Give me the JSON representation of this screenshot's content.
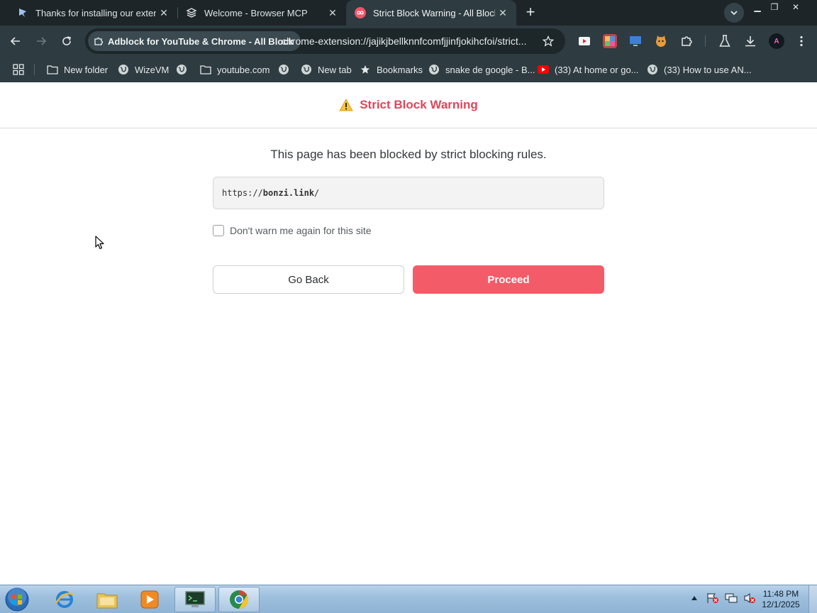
{
  "tabs": [
    {
      "title": "Thanks for installing our extension",
      "icon": "feather-icon"
    },
    {
      "title": "Welcome - Browser MCP",
      "icon": "stack-icon"
    },
    {
      "title": "Strict Block Warning - All Block",
      "icon": "infinity-icon",
      "active": true
    }
  ],
  "toolbar": {
    "site_chip": "Adblock for YouTube & Chrome - All Block",
    "url": "chrome-extension://jajikjbellknnfcomfjjinfjokihcfoi/strict..."
  },
  "bookmarks": [
    {
      "label": "New folder",
      "icon": "folder-icon"
    },
    {
      "label": "WizeVM",
      "icon": "globe-icon"
    },
    {
      "label": "",
      "icon": "globe-icon"
    },
    {
      "label": "youtube.com",
      "icon": "folder-icon"
    },
    {
      "label": "",
      "icon": "globe-icon"
    },
    {
      "label": "New tab",
      "icon": "globe-icon"
    },
    {
      "label": "Bookmarks",
      "icon": "star-icon"
    },
    {
      "label": "snake de google - B...",
      "icon": "globe-icon"
    },
    {
      "label": "(33) At home or go...",
      "icon": "youtube-icon"
    },
    {
      "label": "(33) How to use AN...",
      "icon": "globe-icon"
    }
  ],
  "page": {
    "title": "Strict Block Warning",
    "message": "This page has been blocked by strict blocking rules.",
    "blocked_url_prefix": "https://",
    "blocked_url_host": "bonzi.link",
    "blocked_url_suffix": "/",
    "dont_warn_label": "Don't warn me again for this site",
    "dont_warn_checked": false,
    "go_back_label": "Go Back",
    "proceed_label": "Proceed"
  },
  "colors": {
    "accent": "#e0455a",
    "proceed_bg": "#f45b69",
    "chrome_frame": "#1d2528",
    "chrome_toolbar": "#2e3b40"
  },
  "taskbar": {
    "time": "11:48 PM",
    "date": "12/1/2025"
  }
}
